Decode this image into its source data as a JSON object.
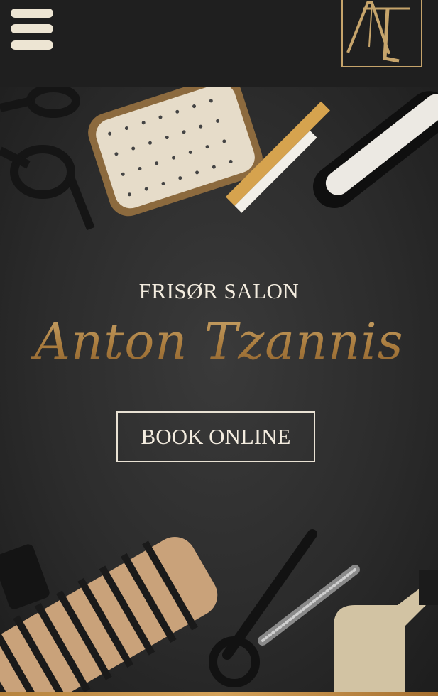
{
  "header": {
    "menu_icon": "hamburger-menu-icon",
    "logo_text": "AT",
    "logo_color": "#c6a46b"
  },
  "hero": {
    "kicker": "FRISØR SALON",
    "title": "Anton Tzannis",
    "book_button": "BOOK ONLINE"
  },
  "colors": {
    "header_bg": "#1f1f1f",
    "hero_bg": "#2c2c2c",
    "gold": "#b78d4e",
    "cream": "#f3ecdf"
  }
}
